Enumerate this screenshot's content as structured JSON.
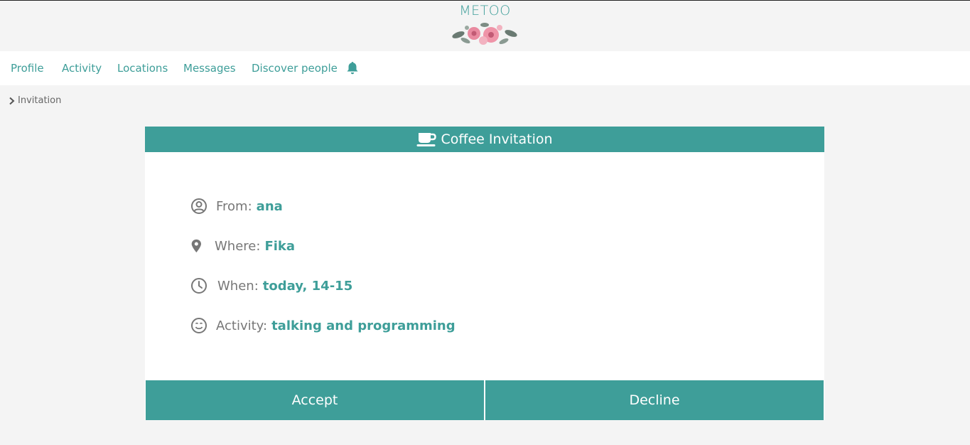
{
  "app": {
    "brand": "METOO"
  },
  "nav": {
    "items": [
      {
        "label": "Profile"
      },
      {
        "label": "Activity"
      },
      {
        "label": "Locations"
      },
      {
        "label": "Messages"
      },
      {
        "label": "Discover people"
      }
    ],
    "notification_icon": "bell-icon"
  },
  "breadcrumb": {
    "current": "Invitation"
  },
  "invitation": {
    "title": "Coffee Invitation",
    "title_icon": "coffee-cup-icon",
    "rows": [
      {
        "icon": "user-circle-icon",
        "label": "From:",
        "value": "ana"
      },
      {
        "icon": "map-pin-icon",
        "label": "Where:",
        "value": "Fika"
      },
      {
        "icon": "clock-icon",
        "label": "When:",
        "value": "today, 14-15"
      },
      {
        "icon": "smile-icon",
        "label": "Activity:",
        "value": "talking and programming"
      }
    ],
    "accept_label": "Accept",
    "decline_label": "Decline"
  },
  "colors": {
    "accent": "#3e9e99",
    "text_muted": "#777777",
    "background": "#f4f4f4"
  }
}
